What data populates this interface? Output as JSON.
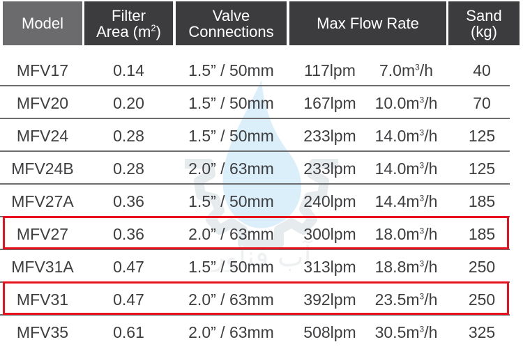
{
  "headers": {
    "model": "Model",
    "filter_area_line1": "Filter",
    "filter_area_line2": "Area (m",
    "filter_area_sup": "2",
    "filter_area_close": ")",
    "valve_line1": "Valve",
    "valve_line2": "Connections",
    "flow": "Max Flow Rate",
    "sand_line1": "Sand",
    "sand_line2": "(kg)"
  },
  "unit_sup": "3",
  "unit_suffix": "/h",
  "rows": [
    {
      "model": "MFV17",
      "area": "0.14",
      "valve": "1.5” / 50mm",
      "lpm": "117lpm",
      "m3h": "7.0m",
      "sand": "40",
      "highlighted": false
    },
    {
      "model": "MFV20",
      "area": "0.20",
      "valve": "1.5” / 50mm",
      "lpm": "167lpm",
      "m3h": "10.0m",
      "sand": "70",
      "highlighted": false
    },
    {
      "model": "MFV24",
      "area": "0.28",
      "valve": "1.5” / 50mm",
      "lpm": "233lpm",
      "m3h": "14.0m",
      "sand": "125",
      "highlighted": false
    },
    {
      "model": "MFV24B",
      "area": "0.28",
      "valve": "2.0” / 63mm",
      "lpm": "233lpm",
      "m3h": "14.0m",
      "sand": "125",
      "highlighted": false
    },
    {
      "model": "MFV27A",
      "area": "0.36",
      "valve": "1.5” / 50mm",
      "lpm": "240lpm",
      "m3h": "14.4m",
      "sand": "185",
      "highlighted": false
    },
    {
      "model": "MFV27",
      "area": "0.36",
      "valve": "2.0” / 63mm",
      "lpm": "300lpm",
      "m3h": "18.0m",
      "sand": "185",
      "highlighted": true
    },
    {
      "model": "MFV31A",
      "area": "0.47",
      "valve": "1.5” / 50mm",
      "lpm": "313lpm",
      "m3h": "18.8m",
      "sand": "250",
      "highlighted": false
    },
    {
      "model": "MFV31",
      "area": "0.47",
      "valve": "2.0” / 63mm",
      "lpm": "392lpm",
      "m3h": "23.5m",
      "sand": "250",
      "highlighted": true
    },
    {
      "model": "MFV35",
      "area": "0.61",
      "valve": "2.0” / 63mm",
      "lpm": "508lpm",
      "m3h": "30.5m",
      "sand": "325",
      "highlighted": false
    }
  ],
  "colors": {
    "header_bg": "#3c3b3d",
    "model_header_bg": "#6b6b6d",
    "highlight": "#e8121e",
    "text": "#3e3e40"
  },
  "watermark_text": "آب فناور"
}
